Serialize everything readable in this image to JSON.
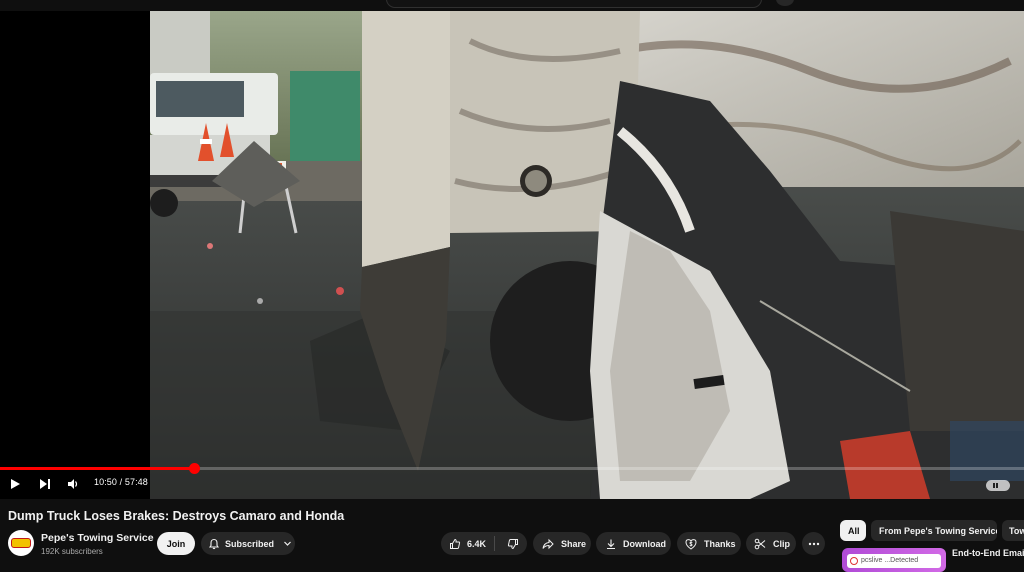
{
  "player": {
    "current_time": "10:50",
    "duration": "57:48",
    "time_separator": "/",
    "progress_fraction": 0.189,
    "progress_color": "#ff0000"
  },
  "video": {
    "title": "Dump Truck Loses Brakes: Destroys Camaro and Honda"
  },
  "channel": {
    "name": "Pepe's Towing Service",
    "subscribers": "192K subscribers",
    "join_label": "Join",
    "subscribed_label": "Subscribed"
  },
  "actions": {
    "like_count": "6.4K",
    "share_label": "Share",
    "download_label": "Download",
    "thanks_label": "Thanks",
    "clip_label": "Clip"
  },
  "chips": {
    "all": "All",
    "from_channel": "From Pepe's Towing Service",
    "truncated": "Tow"
  },
  "ad": {
    "card_text": "pcslive  ...Detected",
    "title": "End-to-End Email I"
  },
  "icons": {
    "play": "play-icon",
    "next": "next-icon",
    "volume": "volume-icon",
    "bell": "bell-icon",
    "chevron": "chevron-down-icon",
    "like": "thumbs-up-icon",
    "dislike": "thumbs-down-icon",
    "share": "share-arrow-icon",
    "download": "download-icon",
    "thanks": "dollar-heart-icon",
    "clip": "scissors-icon",
    "more": "more-horizontal-icon"
  }
}
